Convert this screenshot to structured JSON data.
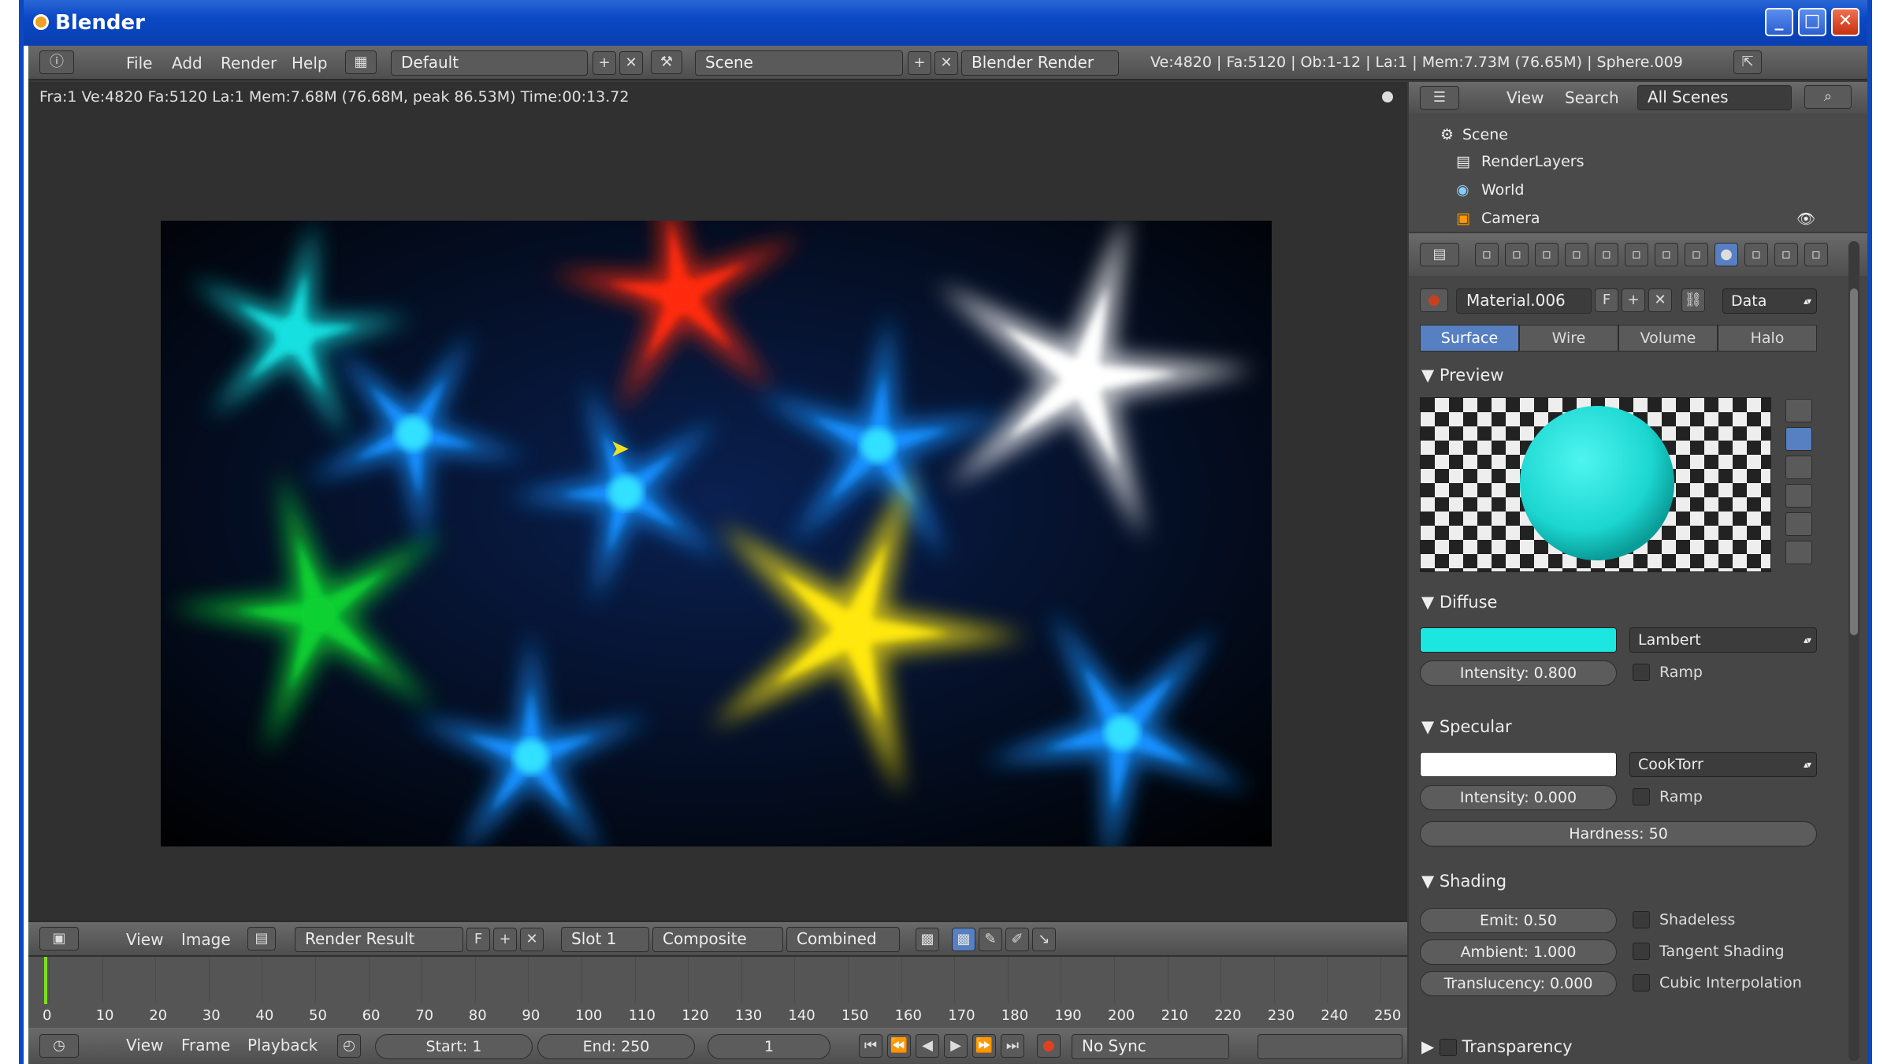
{
  "window": {
    "title": "Blender"
  },
  "topbar": {
    "menus": [
      "File",
      "Add",
      "Render",
      "Help"
    ],
    "screen_layout": "Default",
    "scene": "Scene",
    "engine": "Blender Render",
    "stats": "Ve:4820 | Fa:5120 | Ob:1-12 | La:1 | Mem:7.73M (76.65M) | Sphere.009"
  },
  "viewer": {
    "render_info": "Fra:1  Ve:4820 Fa:5120 La:1 Mem:7.68M (76.68M, peak 86.53M) Time:00:13.72"
  },
  "image_header": {
    "menus": [
      "View",
      "Image"
    ],
    "image_name": "Render Result",
    "image_flag": "F",
    "slot": "Slot 1",
    "layer": "Composite",
    "pass": "Combined"
  },
  "timeline": {
    "ticks": [
      "0",
      "10",
      "20",
      "30",
      "40",
      "50",
      "60",
      "70",
      "80",
      "90",
      "100",
      "110",
      "120",
      "130",
      "140",
      "150",
      "160",
      "170",
      "180",
      "190",
      "200",
      "210",
      "220",
      "230",
      "240",
      "250"
    ]
  },
  "timeline_header": {
    "menus": [
      "View",
      "Frame",
      "Playback"
    ],
    "start": "Start: 1",
    "end": "End: 250",
    "current": "1",
    "sync": "No Sync"
  },
  "outliner": {
    "menus": [
      "View",
      "Search"
    ],
    "filter": "All Scenes",
    "items": [
      "Scene",
      "RenderLayers",
      "World",
      "Camera"
    ]
  },
  "properties": {
    "material_name": "Material.006",
    "material_flag": "F",
    "link": "Data",
    "tabs": [
      "Surface",
      "Wire",
      "Volume",
      "Halo"
    ],
    "active_tab": "Surface",
    "preview_title": "Preview",
    "diffuse": {
      "title": "Diffuse",
      "color": "#1ce6e0",
      "shader": "Lambert",
      "intensity": "Intensity: 0.800",
      "ramp": "Ramp"
    },
    "specular": {
      "title": "Specular",
      "color": "#ffffff",
      "shader": "CookTorr",
      "intensity": "Intensity: 0.000",
      "ramp": "Ramp",
      "hardness": "Hardness: 50"
    },
    "shading": {
      "title": "Shading",
      "emit": "Emit: 0.50",
      "ambient": "Ambient: 1.000",
      "translucency": "Translucency: 0.000",
      "shadeless": "Shadeless",
      "tangent": "Tangent Shading",
      "cubic": "Cubic Interpolation"
    },
    "transparency": "Transparency"
  },
  "colors": {
    "accent": "#5680c2",
    "titlebar": "#0a48c4"
  }
}
